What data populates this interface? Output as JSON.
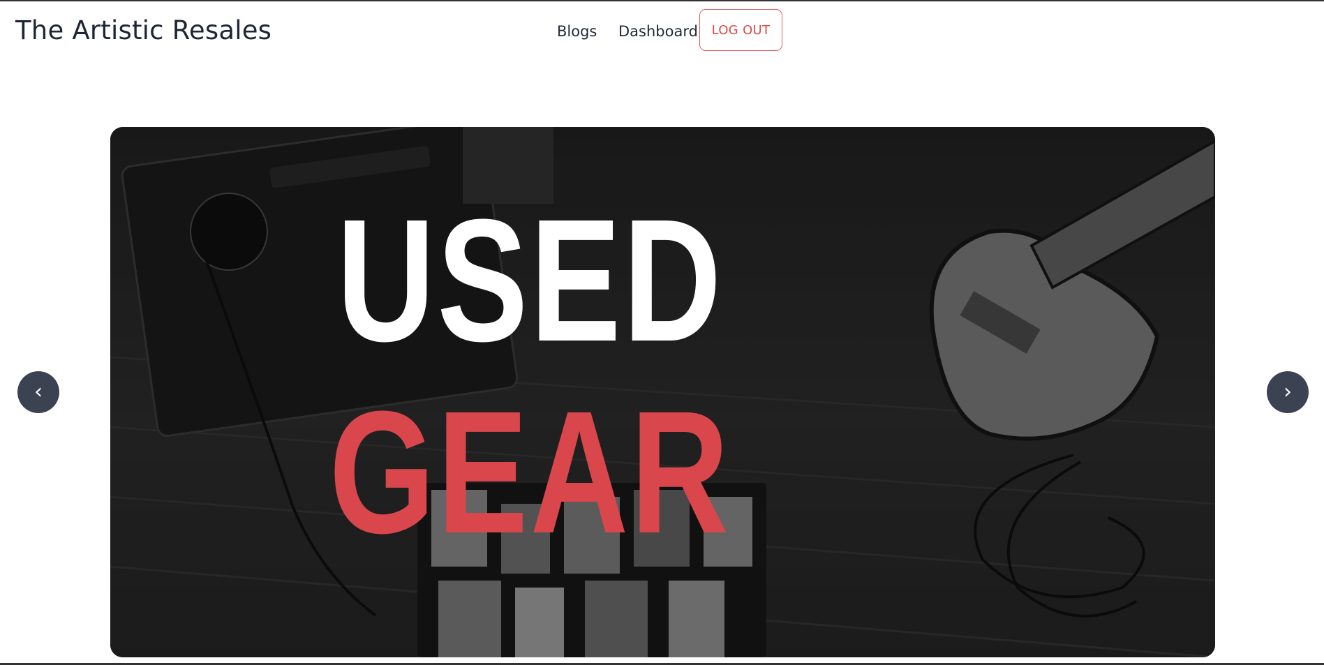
{
  "header": {
    "brand": "The Artistic Resales",
    "nav": [
      {
        "label": "Blogs"
      },
      {
        "label": "Dashboard"
      }
    ],
    "logout_label": "LOG OUT"
  },
  "carousel": {
    "slide": {
      "line1": "USED",
      "line2": "GEAR",
      "line1_color": "#ffffff",
      "line2_color": "#d9474d"
    },
    "prev_icon": "chevron-left-icon",
    "next_icon": "chevron-right-icon",
    "prev_glyph": "‹",
    "next_glyph": "›"
  },
  "colors": {
    "accent": "#e04848",
    "arrow_bg": "#3b4252",
    "text": "#1e2534"
  }
}
